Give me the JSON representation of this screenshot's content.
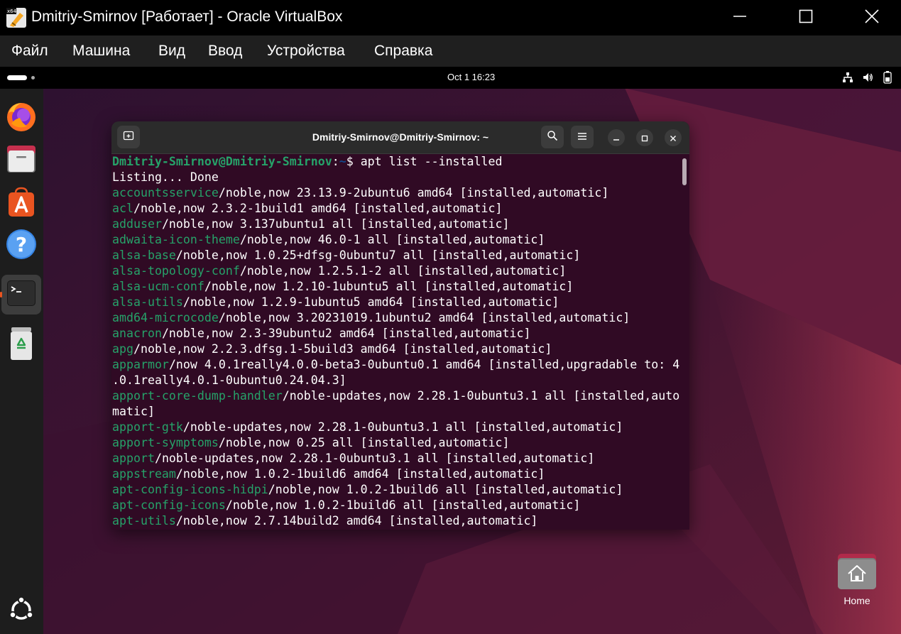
{
  "window": {
    "title": "Dmitriy-Smirnov [Работает] - Oracle VirtualBox",
    "app_icon": "virtualbox-icon"
  },
  "menubar": {
    "items": [
      "Файл",
      "Машина",
      "Вид",
      "Ввод",
      "Устройства",
      "Справка"
    ]
  },
  "topbar": {
    "clock": "Oct 1  16:23",
    "status_icons": [
      "network-icon",
      "volume-icon",
      "battery-icon"
    ]
  },
  "dock": {
    "items": [
      "firefox-icon",
      "files-icon",
      "app-center-icon",
      "help-icon",
      "terminal-icon",
      "trash-icon",
      "show-apps-icon"
    ]
  },
  "terminal": {
    "title": "Dmitriy-Smirnov@Dmitriy-Smirnov: ~",
    "prompt_user": "Dmitriy-Smirnov@Dmitriy-Smirnov",
    "prompt_sep": ":",
    "prompt_path": "~",
    "prompt_end": "$ ",
    "command": "apt list --installed",
    "listing_line": "Listing... Done",
    "packages": [
      {
        "name": "accountsservice",
        "info": "/noble,now 23.13.9-2ubuntu6 amd64 [installed,automatic]"
      },
      {
        "name": "acl",
        "info": "/noble,now 2.3.2-1build1 amd64 [installed,automatic]"
      },
      {
        "name": "adduser",
        "info": "/noble,now 3.137ubuntu1 all [installed,automatic]"
      },
      {
        "name": "adwaita-icon-theme",
        "info": "/noble,now 46.0-1 all [installed,automatic]"
      },
      {
        "name": "alsa-base",
        "info": "/noble,now 1.0.25+dfsg-0ubuntu7 all [installed,automatic]"
      },
      {
        "name": "alsa-topology-conf",
        "info": "/noble,now 1.2.5.1-2 all [installed,automatic]"
      },
      {
        "name": "alsa-ucm-conf",
        "info": "/noble,now 1.2.10-1ubuntu5 all [installed,automatic]"
      },
      {
        "name": "alsa-utils",
        "info": "/noble,now 1.2.9-1ubuntu5 amd64 [installed,automatic]"
      },
      {
        "name": "amd64-microcode",
        "info": "/noble,now 3.20231019.1ubuntu2 amd64 [installed,automatic]"
      },
      {
        "name": "anacron",
        "info": "/noble,now 2.3-39ubuntu2 amd64 [installed,automatic]"
      },
      {
        "name": "apg",
        "info": "/noble,now 2.2.3.dfsg.1-5build3 amd64 [installed,automatic]"
      },
      {
        "name": "apparmor",
        "info": "/now 4.0.1really4.0.0-beta3-0ubuntu0.1 amd64 [installed,upgradable to: 4",
        "cont": ".0.1really4.0.1-0ubuntu0.24.04.3]"
      },
      {
        "name": "apport-core-dump-handler",
        "info": "/noble-updates,now 2.28.1-0ubuntu3.1 all [installed,auto",
        "cont": "matic]"
      },
      {
        "name": "apport-gtk",
        "info": "/noble-updates,now 2.28.1-0ubuntu3.1 all [installed,automatic]"
      },
      {
        "name": "apport-symptoms",
        "info": "/noble,now 0.25 all [installed,automatic]"
      },
      {
        "name": "apport",
        "info": "/noble-updates,now 2.28.1-0ubuntu3.1 all [installed,automatic]"
      },
      {
        "name": "appstream",
        "info": "/noble,now 1.0.2-1build6 amd64 [installed,automatic]"
      },
      {
        "name": "apt-config-icons-hidpi",
        "info": "/noble,now 1.0.2-1build6 all [installed,automatic]"
      },
      {
        "name": "apt-config-icons",
        "info": "/noble,now 1.0.2-1build6 all [installed,automatic]"
      },
      {
        "name": "apt-utils",
        "info": "/noble,now 2.7.14build2 amd64 [installed,automatic]"
      }
    ]
  },
  "desktop": {
    "home_label": "Home"
  }
}
